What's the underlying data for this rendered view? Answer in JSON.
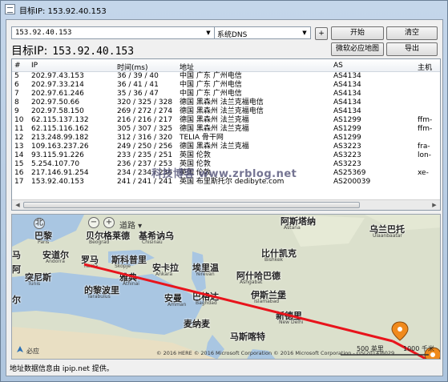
{
  "window": {
    "title": "目标IP: 153.92.40.153"
  },
  "toolbar": {
    "host_value": "153.92.40.153",
    "dns_value": "系统DNS",
    "add_label": "+",
    "start_label": "开始",
    "clear_label": "清空",
    "map_label": "微软必应地图",
    "export_label": "导出"
  },
  "target": {
    "label": "目标IP:",
    "ip": "153.92.40.153"
  },
  "table": {
    "headers": [
      "#",
      "IP",
      "时间(ms)",
      "地址",
      "AS",
      "主机"
    ],
    "rows": [
      [
        "5",
        "202.97.43.153",
        "36 / 39 / 40",
        "中国 广东 广州电信",
        "AS4134",
        ""
      ],
      [
        "6",
        "202.97.33.214",
        "36 / 41 / 41",
        "中国 广东 广州电信",
        "AS4134",
        ""
      ],
      [
        "7",
        "202.97.61.246",
        "35 / 36 / 47",
        "中国 广东 广州电信",
        "AS4134",
        ""
      ],
      [
        "8",
        "202.97.50.66",
        "320 / 325 / 328",
        "德国 黑森州 法兰克福电信",
        "AS4134",
        ""
      ],
      [
        "9",
        "202.97.58.150",
        "269 / 272 / 274",
        "德国 黑森州 法兰克福电信",
        "AS4134",
        ""
      ],
      [
        "10",
        "62.115.137.132",
        "216 / 216 / 217",
        "德国 黑森州 法兰克福",
        "AS1299",
        "ffm-"
      ],
      [
        "11",
        "62.115.116.162",
        "305 / 307 / 325",
        "德国 黑森州 法兰克福",
        "AS1299",
        "ffm-"
      ],
      [
        "12",
        "213.248.99.182",
        "312 / 316 / 320",
        "TELIA 骨干网",
        "AS1299",
        ""
      ],
      [
        "13",
        "109.163.237.26",
        "249 / 250 / 256",
        "德国 黑森州 法兰克福",
        "AS3223",
        "fra-"
      ],
      [
        "14",
        "93.115.91.226",
        "233 / 235 / 251",
        "英国 伦敦",
        "AS3223",
        "lon-"
      ],
      [
        "15",
        "5.254.107.70",
        "236 / 237 / 253",
        "英国 伦敦",
        "AS3223",
        ""
      ],
      [
        "16",
        "217.146.91.254",
        "234 / 234 / 236",
        "英国 伦敦",
        "AS25369",
        "xe-"
      ],
      [
        "17",
        "153.92.40.153",
        "241 / 241 / 241",
        "英国 布里斯托尔 dedibyte.com",
        "AS200039",
        ""
      ]
    ]
  },
  "watermark": "科技博客 www.zrblog.net",
  "map": {
    "nav_glyph": "北",
    "zoom_out": "−",
    "zoom_in": "+",
    "road_label": "道路",
    "cities": [
      {
        "name": "巴黎",
        "sub": "Paris"
      },
      {
        "name": "贝尔格莱德",
        "sub": "Beograd"
      },
      {
        "name": "基希讷乌",
        "sub": "Chisinau"
      },
      {
        "name": "安道尔",
        "sub": "Andorra"
      },
      {
        "name": "罗马",
        "sub": "Roma"
      },
      {
        "name": "斯科普里",
        "sub": "Skopje"
      },
      {
        "name": "安卡拉",
        "sub": "Ankara"
      },
      {
        "name": "埃里温",
        "sub": "Yerevan"
      },
      {
        "name": "阿什哈巴德",
        "sub": "Ashgabat"
      },
      {
        "name": "突尼斯",
        "sub": "Tunis"
      },
      {
        "name": "雅典",
        "sub": "Athinai"
      },
      {
        "name": "的黎波里",
        "sub": "Tarabulus"
      },
      {
        "name": "安曼",
        "sub": "Amman"
      },
      {
        "name": "巴格达",
        "sub": "Baghdad"
      },
      {
        "name": "伊斯兰堡",
        "sub": "Islamabad"
      },
      {
        "name": "新德里",
        "sub": "New Delhi"
      },
      {
        "name": "麦纳麦",
        "sub": ""
      },
      {
        "name": "马斯喀特",
        "sub": ""
      },
      {
        "name": "比什凯克",
        "sub": "Bishkek"
      },
      {
        "name": "阿斯塔纳",
        "sub": "Astana"
      },
      {
        "name": "乌兰巴托",
        "sub": "Ulaanbaatar"
      },
      {
        "name": "马",
        "sub": ""
      },
      {
        "name": "阿",
        "sub": ""
      },
      {
        "name": "尔",
        "sub": ""
      }
    ],
    "scale_km": "500 英里",
    "scale_km2": "1000 千米",
    "bing_label": "必应",
    "copyright": "© 2016 HERE   © 2016 Microsoft Corporation   © 2016 Microsoft Corporation - GS(2014)6029"
  },
  "status": "地址数据信息由 ipip.net 提供。",
  "colors": {
    "route": "#e8141c",
    "pin": "#f08a1c",
    "map_bg": "#dbe0cc"
  }
}
